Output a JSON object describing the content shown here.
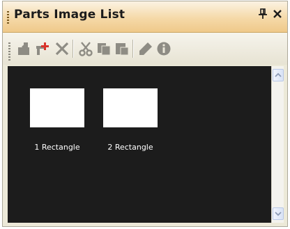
{
  "panel": {
    "title": "Parts Image List",
    "pin_glyph": "Ԅ",
    "close_glyph": "×"
  },
  "toolbar": {
    "icons": [
      "import-icon",
      "add-parts-icon",
      "delete-icon",
      "cut-icon",
      "copy-icon",
      "paste-icon",
      "edit-icon",
      "properties-icon"
    ]
  },
  "parts": [
    {
      "label": "1 Rectangle"
    },
    {
      "label": "2 Rectangle"
    }
  ],
  "colors": {
    "title_bar": "#f5d9a8",
    "content_bg": "#1c1c1c",
    "thumb_fill": "#ffffff",
    "icon_gray": "#8e8c84"
  }
}
